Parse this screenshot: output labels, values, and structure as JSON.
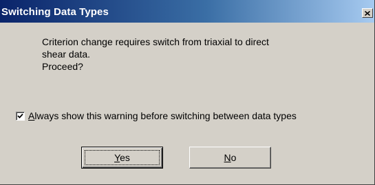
{
  "dialog": {
    "title": "Switching Data Types",
    "close_icon": "close-icon",
    "message_lines": [
      "Criterion change requires switch from triaxial to direct",
      "shear data.",
      "Proceed?"
    ],
    "checkbox": {
      "checked": true,
      "mnemonic": "A",
      "label_rest": "lways show this warning before switching between data types"
    },
    "buttons": {
      "yes": {
        "mnemonic": "Y",
        "rest": "es",
        "default": true
      },
      "no": {
        "mnemonic": "N",
        "rest": "o",
        "default": false
      }
    }
  },
  "colors": {
    "title_gradient_start": "#0a246a",
    "title_gradient_end": "#a6caf0",
    "face": "#d4d0c8"
  }
}
